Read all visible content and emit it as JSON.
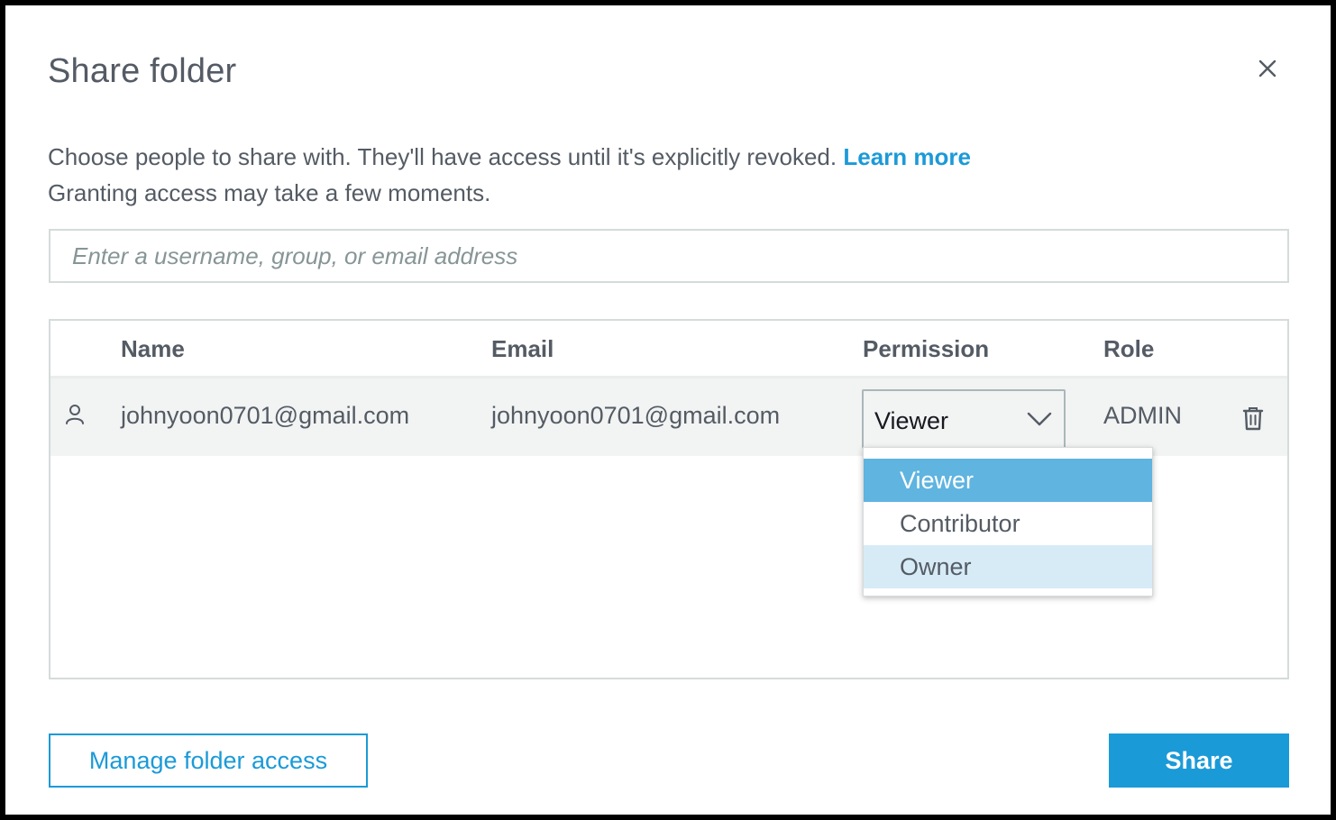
{
  "dialog": {
    "title": "Share folder",
    "close_icon": "close-icon"
  },
  "description": {
    "line1": "Choose people to share with. They'll have access until it's explicitly revoked.",
    "learn_more": "Learn more",
    "line2": "Granting access may take a few moments."
  },
  "search": {
    "placeholder": "Enter a username, group, or email address",
    "value": ""
  },
  "table": {
    "headers": [
      "Name",
      "Email",
      "Permission",
      "Role"
    ],
    "rows": [
      {
        "icon": "user-icon",
        "name": "johnyoon0701@gmail.com",
        "email": "johnyoon0701@gmail.com",
        "permission": "Viewer",
        "role": "ADMIN",
        "action_icon": "trash-icon"
      }
    ]
  },
  "permission_menu": {
    "options": [
      "Viewer",
      "Contributor",
      "Owner"
    ],
    "selected": "Viewer",
    "hovered": "Owner"
  },
  "footer": {
    "manage_label": "Manage folder access",
    "share_label": "Share"
  },
  "colors": {
    "accent": "#1b9ad8",
    "selected_option": "#5fb4e0",
    "hover_option": "#d7ebf7",
    "row_background": "#f2f3f3"
  }
}
